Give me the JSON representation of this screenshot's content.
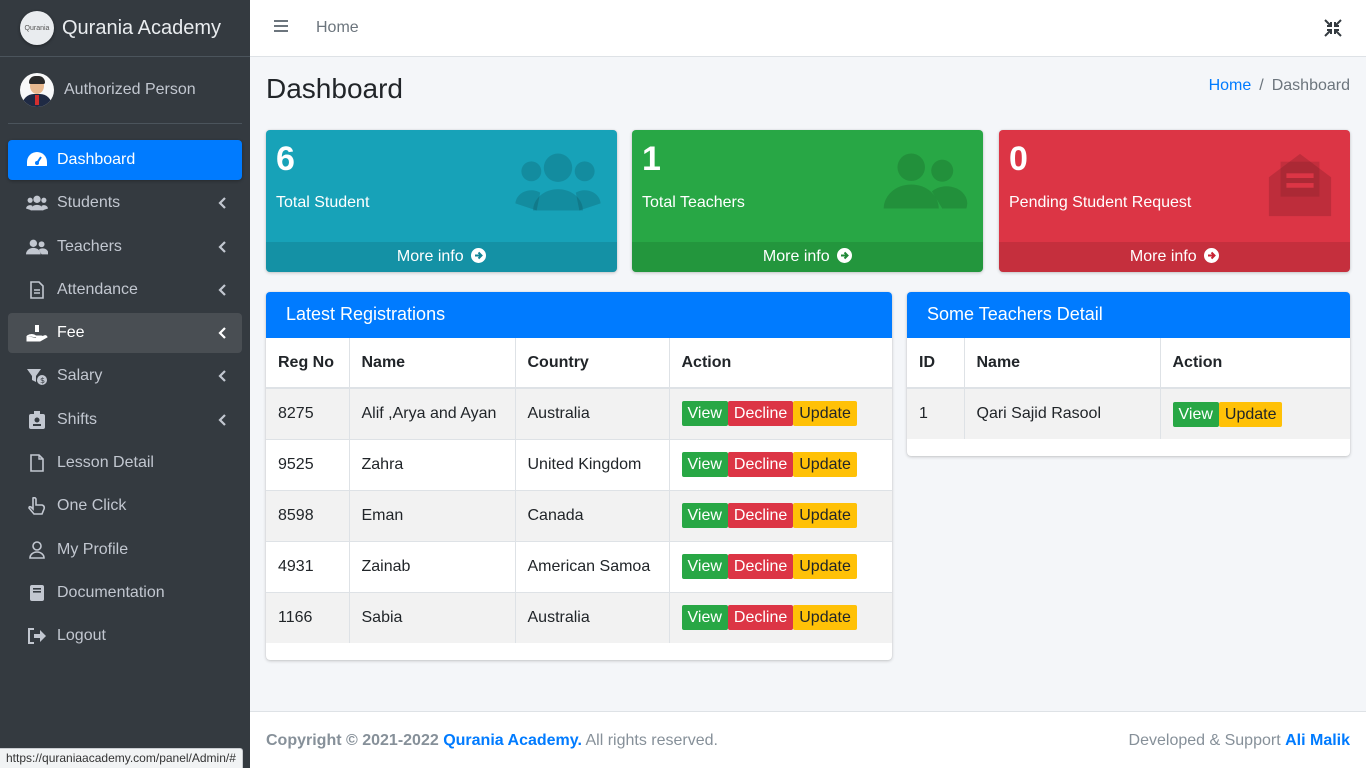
{
  "brand": {
    "name": "Qurania Academy",
    "logo_text": "Qurania"
  },
  "user": {
    "name": "Authorized Person"
  },
  "sidebar": {
    "items": [
      {
        "label": "Dashboard",
        "icon": "tachometer-icon",
        "active": true,
        "caret": false
      },
      {
        "label": "Students",
        "icon": "users-icon",
        "caret": true
      },
      {
        "label": "Teachers",
        "icon": "user-friends-icon",
        "caret": true
      },
      {
        "label": "Attendance",
        "icon": "file-icon",
        "caret": true
      },
      {
        "label": "Fee",
        "icon": "hand-holding-icon",
        "caret": true,
        "hover": true
      },
      {
        "label": "Salary",
        "icon": "money-icon",
        "caret": true
      },
      {
        "label": "Shifts",
        "icon": "id-badge-icon",
        "caret": true
      },
      {
        "label": "Lesson Detail",
        "icon": "document-icon",
        "caret": false
      },
      {
        "label": "One Click",
        "icon": "pointer-hand-icon",
        "caret": false
      },
      {
        "label": "My Profile",
        "icon": "user-icon",
        "caret": false
      },
      {
        "label": "Documentation",
        "icon": "book-icon",
        "caret": false
      },
      {
        "label": "Logout",
        "icon": "sign-out-icon",
        "caret": false
      }
    ]
  },
  "topbar": {
    "home_link": "Home"
  },
  "page": {
    "title": "Dashboard",
    "breadcrumb": {
      "home": "Home",
      "current": "Dashboard",
      "separator": "/"
    }
  },
  "stats": [
    {
      "value": "6",
      "label": "Total Student",
      "more": "More info",
      "color": "#17a2b8"
    },
    {
      "value": "1",
      "label": "Total Teachers",
      "more": "More info",
      "color": "#28a745"
    },
    {
      "value": "0",
      "label": "Pending Student Request",
      "more": "More info",
      "color": "#dc3545"
    }
  ],
  "registrations": {
    "title": "Latest Registrations",
    "columns": [
      "Reg No",
      "Name",
      "Country",
      "Action"
    ],
    "rows": [
      {
        "reg": "8275",
        "name": "Alif ,Arya and Ayan",
        "country": "Australia"
      },
      {
        "reg": "9525",
        "name": "Zahra",
        "country": "United Kingdom"
      },
      {
        "reg": "8598",
        "name": "Eman",
        "country": "Canada"
      },
      {
        "reg": "4931",
        "name": "Zainab",
        "country": "American Samoa"
      },
      {
        "reg": "1166",
        "name": "Sabia",
        "country": "Australia"
      }
    ],
    "actions": {
      "view": "View",
      "decline": "Decline",
      "update": "Update"
    }
  },
  "teachers": {
    "title": "Some Teachers Detail",
    "columns": [
      "ID",
      "Name",
      "Action"
    ],
    "rows": [
      {
        "id": "1",
        "name": "Qari Sajid Rasool"
      }
    ],
    "actions": {
      "view": "View",
      "update": "Update"
    }
  },
  "footer": {
    "copyright": "Copyright © 2021-2022",
    "brand_link": "Qurania Academy.",
    "rights": "All rights reserved.",
    "developed": "Developed & Support",
    "developer": "Ali Malik"
  },
  "statusbar": {
    "url": "https://quraniaacademy.com/panel/Admin/#"
  },
  "colors": {
    "sidebar_bg": "#343a40",
    "primary": "#007bff",
    "success": "#28a745",
    "danger": "#dc3545",
    "warning": "#ffc107",
    "info": "#17a2b8"
  }
}
